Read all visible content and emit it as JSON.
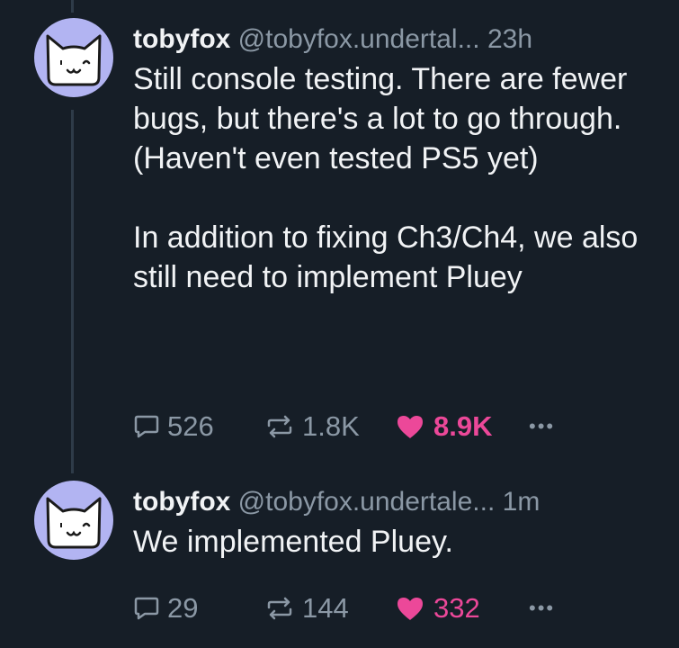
{
  "posts": [
    {
      "display_name": "tobyfox",
      "handle": "@tobyfox.undertal...",
      "time": "23h",
      "text": "Still console testing. There are fewer bugs, but there's a lot to go through. (Haven't even tested PS5 yet)\n\nIn addition to fixing Ch3/Ch4, we also still need to implement Pluey",
      "replies": "526",
      "reposts": "1.8K",
      "likes": "8.9K",
      "avatar_icon": "cat-face-icon"
    },
    {
      "display_name": "tobyfox",
      "handle": "@tobyfox.undertale...",
      "time": "1m",
      "text": "We implemented Pluey.",
      "replies": "29",
      "reposts": "144",
      "likes": "332",
      "avatar_icon": "cat-face-icon"
    }
  ],
  "colors": {
    "background": "#161e27",
    "text": "#f1f3f5",
    "muted": "#8b98a5",
    "like": "#ec4899",
    "avatar_bg": "#b2b4f2",
    "thread_line": "#2e3b48"
  }
}
